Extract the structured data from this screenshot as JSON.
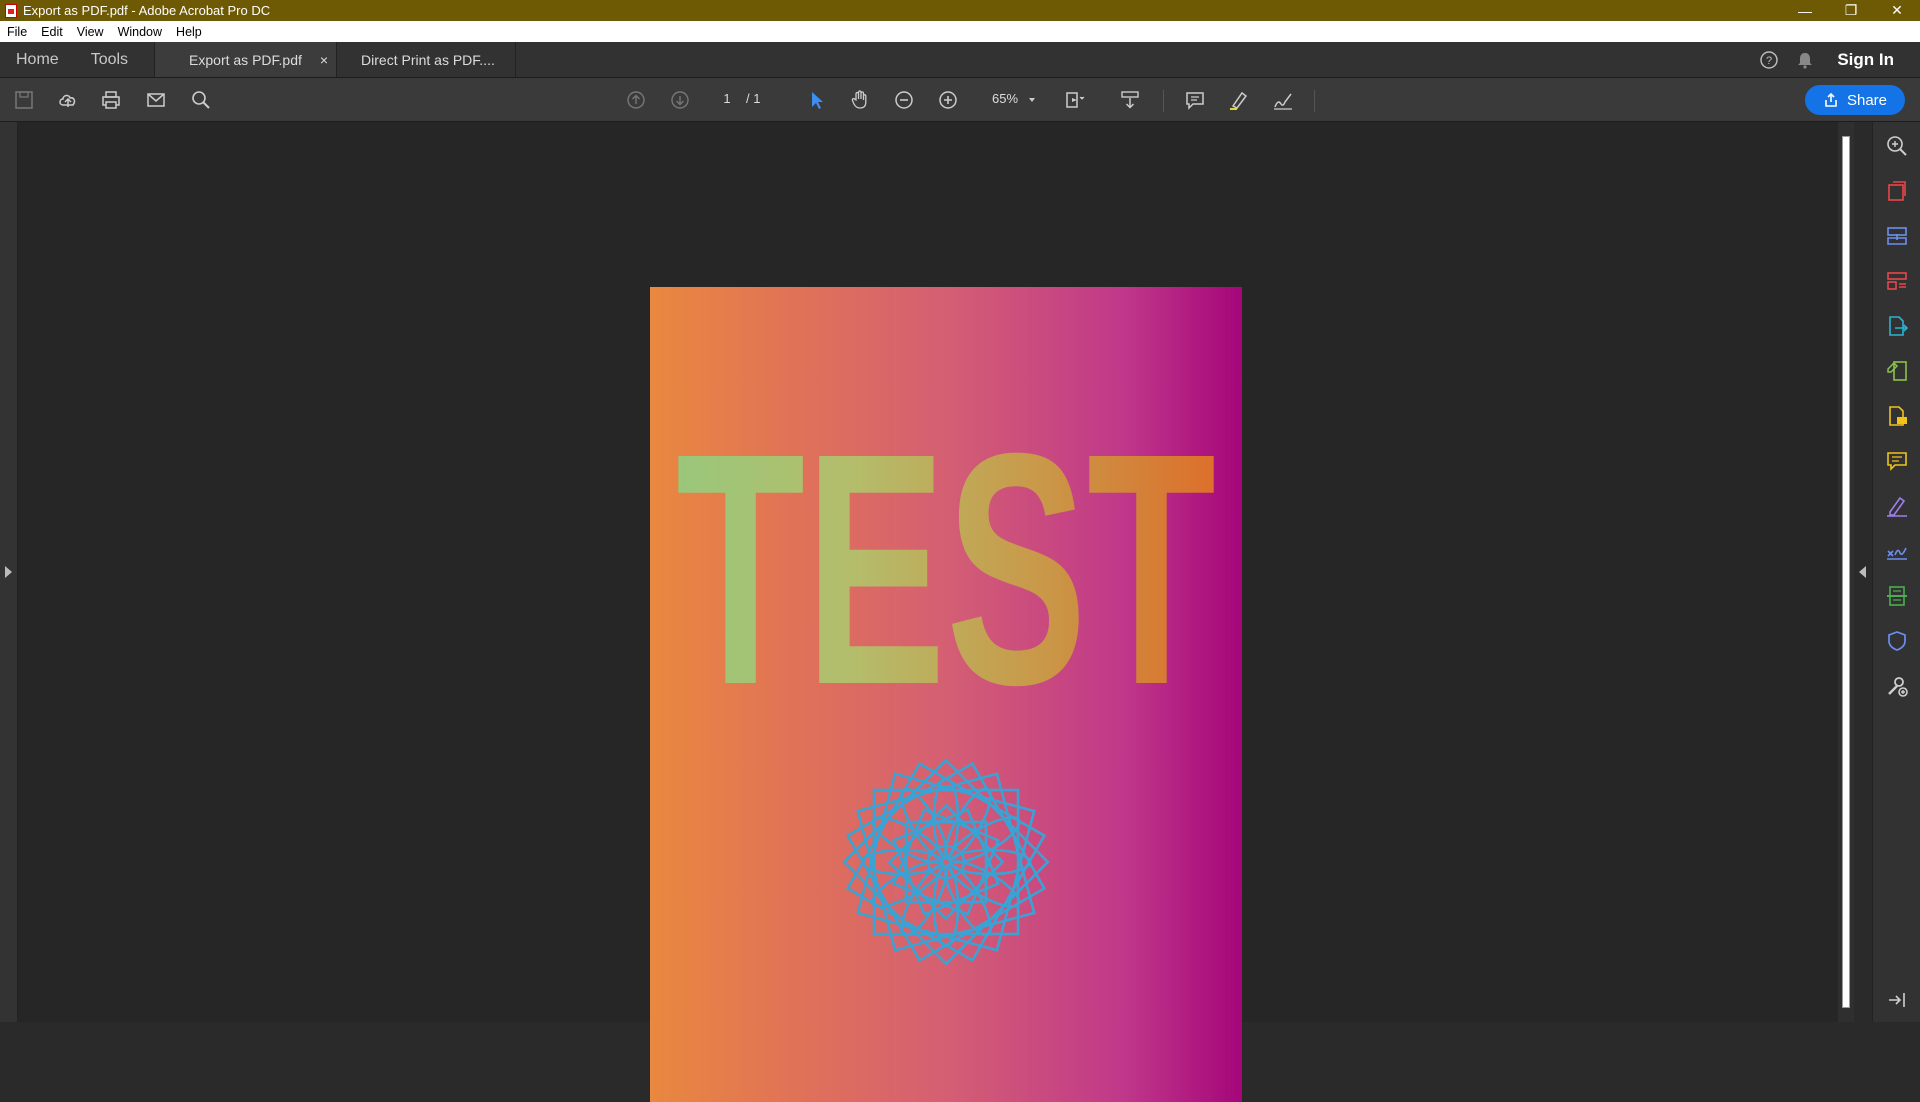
{
  "window": {
    "title": "Export as PDF.pdf - Adobe Acrobat Pro DC"
  },
  "menu": [
    "File",
    "Edit",
    "View",
    "Window",
    "Help"
  ],
  "tabs": {
    "home": "Home",
    "tools": "Tools",
    "documents": [
      {
        "label": "Export as PDF.pdf",
        "active": true,
        "close": "×"
      },
      {
        "label": "Direct Print as PDF....",
        "active": false
      }
    ]
  },
  "header": {
    "sign_in": "Sign In"
  },
  "toolbar": {
    "page_current": "1",
    "page_total": "/ 1",
    "zoom": "65%",
    "share_label": "Share"
  },
  "document": {
    "heading": "TEST",
    "heading_colors": [
      "#9ac77a",
      "#b4bd6b",
      "#c89a4a",
      "#dd6f2b"
    ],
    "gradient": [
      "#e9883f",
      "#d45f73",
      "#a5067a"
    ],
    "ornament_color": "#3aa3d4"
  },
  "right_rail_icons": [
    {
      "name": "zoom-search-icon",
      "color": "#cfcfcf"
    },
    {
      "name": "create-pdf-icon",
      "color": "#e8474a"
    },
    {
      "name": "combine-files-icon",
      "color": "#6b8ef0"
    },
    {
      "name": "organize-pages-icon",
      "color": "#e8474a"
    },
    {
      "name": "export-pdf-icon",
      "color": "#2ab3d4"
    },
    {
      "name": "edit-pdf-icon",
      "color": "#8bc34a"
    },
    {
      "name": "request-signature-icon",
      "color": "#f2c21b"
    },
    {
      "name": "comment-icon",
      "color": "#f2c21b"
    },
    {
      "name": "fill-sign-icon",
      "color": "#a07ef0"
    },
    {
      "name": "signature-icon",
      "color": "#6b8ef0"
    },
    {
      "name": "scan-ocr-icon",
      "color": "#4caf50"
    },
    {
      "name": "protect-icon",
      "color": "#6b8ef0"
    },
    {
      "name": "more-tools-icon",
      "color": "#cfcfcf"
    }
  ]
}
